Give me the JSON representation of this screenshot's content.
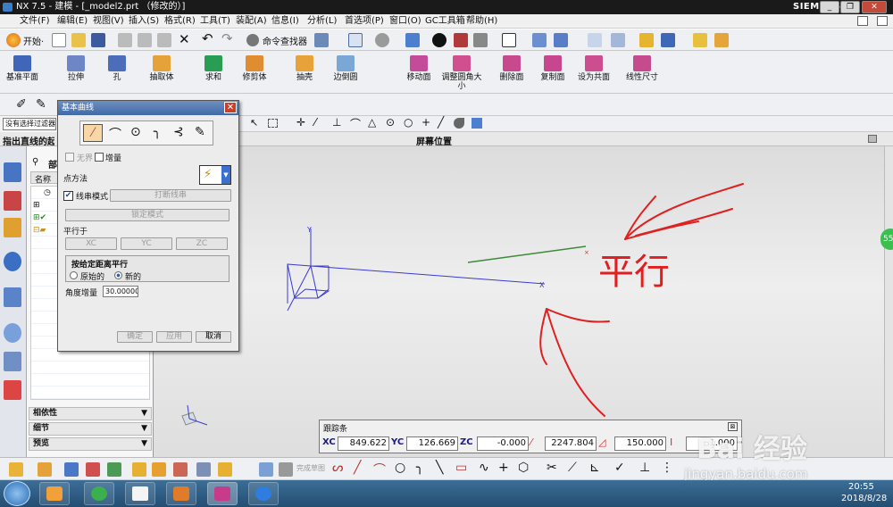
{
  "window": {
    "title": "NX 7.5 - 建模 - [_model2.prt （修改的）]",
    "brand": "SIEMENS",
    "controls": [
      "_",
      "❐",
      "✕"
    ]
  },
  "menu": [
    "文件(F)",
    "编辑(E)",
    "视图(V)",
    "插入(S)",
    "格式(R)",
    "工具(T)",
    "装配(A)",
    "信息(I)",
    "分析(L)",
    "首选项(P)",
    "窗口(O)",
    "GC工具箱",
    "帮助(H)"
  ],
  "toolbar1": {
    "start_label": "开始·",
    "command_finder": "命令查找器"
  },
  "big_buttons": [
    {
      "label": "基准平面",
      "color": "#3f66b8"
    },
    {
      "label": "拉伸",
      "color": "#6f86c6"
    },
    {
      "label": "孔",
      "color": "#4c6db9"
    },
    {
      "label": "抽取体",
      "color": "#e6a23a"
    },
    {
      "label": "求和",
      "color": "#2a9d55"
    },
    {
      "label": "修剪体",
      "color": "#e08c30"
    },
    {
      "label": "抽壳",
      "color": "#e7a33a"
    },
    {
      "label": "边倒圆",
      "color": "#7aa7d6"
    },
    {
      "label": "移动面",
      "color": "#c34b9a"
    },
    {
      "label": "调整圆角大小",
      "color": "#d14f8f"
    },
    {
      "label": "删除面",
      "color": "#c9498f"
    },
    {
      "label": "复制面",
      "color": "#c8468e"
    },
    {
      "label": "设为共面",
      "color": "#cc4d90"
    },
    {
      "label": "线性尺寸",
      "color": "#c54b8e"
    }
  ],
  "filter_text": "没有选择过滤器",
  "prompt_text": "指出直线的起点",
  "viewport_title": "屏幕位置",
  "dialog": {
    "title": "基本曲线",
    "checkbox_unbounded": "无界",
    "checkbox_increment": "增量",
    "point_method_label": "点方法",
    "string_mode_label": "线串模式",
    "string_mode_checked": true,
    "break_string_label": "打断线串",
    "lock_mode_label": "锁定模式",
    "parallel_to_label": "平行于",
    "parallel_buttons": [
      "XC",
      "YC",
      "ZC"
    ],
    "distance_group_label": "按给定距离平行",
    "radio_original": "原始的",
    "radio_new": "新的",
    "radio_selected": "new",
    "angle_increment_label": "角度增量",
    "angle_increment_value": "30.00000",
    "ok_label": "确定",
    "apply_label": "应用",
    "cancel_label": "取消"
  },
  "navigator": {
    "header": "部",
    "column_name": "名称",
    "sections": [
      "相依性",
      "细节",
      "预览"
    ]
  },
  "tracking_bar": {
    "title": "跟踪条",
    "xc_label": "XC",
    "xc_value": "849.622",
    "yc_label": "YC",
    "yc_value": "126.669",
    "zc_label": "ZC",
    "zc_value": "-0.000",
    "length_value": "2247.804",
    "angle_value": "150.000",
    "offset_value": "1.000"
  },
  "sketch_toolbar": {
    "finish_sketch_label": "完成草图"
  },
  "annotation": {
    "text": "平行"
  },
  "tray": {
    "time": "20:55",
    "date": "2018/8/28"
  },
  "watermark": {
    "brand": "Bai 经验",
    "url": "jingyan.baidu.com"
  },
  "side_badge": "55",
  "colors": {
    "title_bar": "#1a1a1a",
    "taskbar": "#2c5a80",
    "dialog_title": "#3f6aa8",
    "annotation_red": "#e02020",
    "line_green": "#3d8a3a",
    "axis_blue": "#3a3ad0"
  }
}
